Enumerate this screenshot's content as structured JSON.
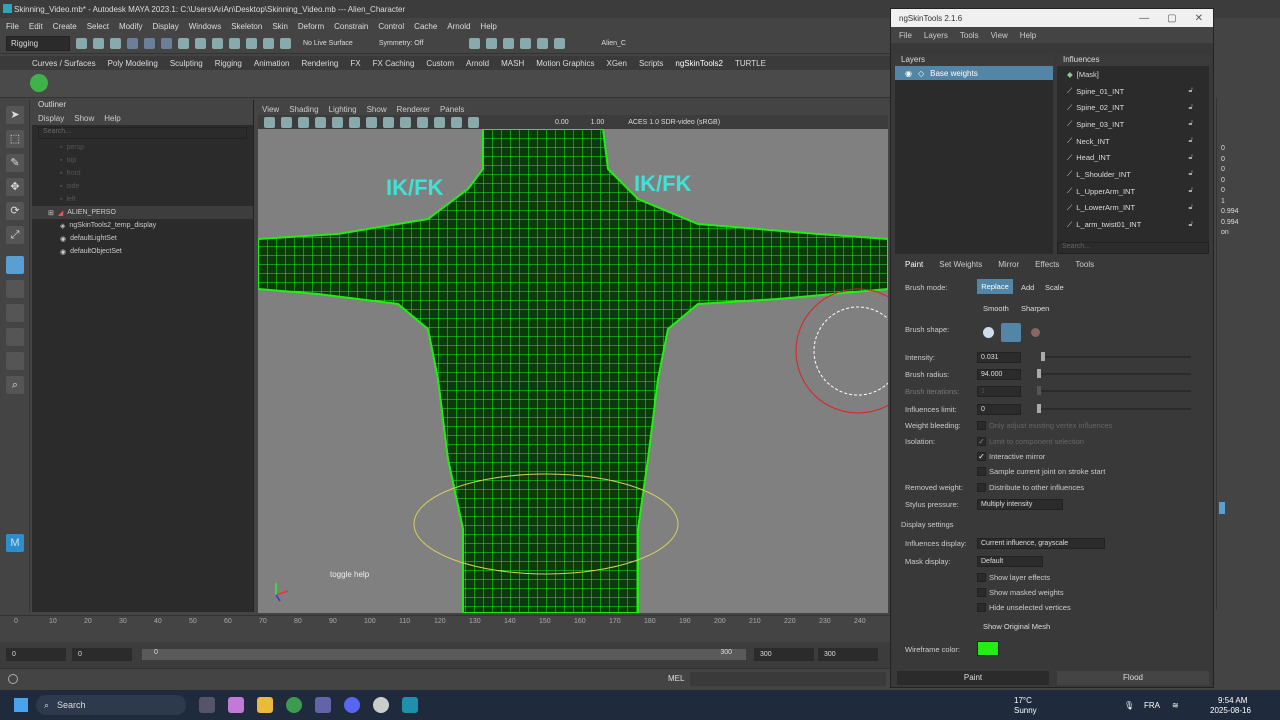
{
  "window": {
    "title": "Skinning_Video.mb* - Autodesk MAYA 2023.1: C:\\Users\\AriAn\\Desktop\\Skinning_Video.mb  ---  Alien_Character"
  },
  "menubar": [
    "File",
    "Edit",
    "Create",
    "Select",
    "Modify",
    "Display",
    "Windows",
    "Skeleton",
    "Skin",
    "Deform",
    "Constrain",
    "Control",
    "Cache",
    "Arnold",
    "Help"
  ],
  "statusline": {
    "menuset": "Rigging",
    "live_surface": "No Live Surface",
    "symmetry": "Symmetry: Off",
    "workspace": "Alien_C"
  },
  "shelf_tabs": [
    "Curves / Surfaces",
    "Poly Modeling",
    "Sculpting",
    "Rigging",
    "Animation",
    "Rendering",
    "FX",
    "FX Caching",
    "Custom",
    "Arnold",
    "MASH",
    "Motion Graphics",
    "XGen",
    "Scripts",
    "ngSkinTools2",
    "TURTLE"
  ],
  "outliner": {
    "title": "Outliner",
    "menu": [
      "Display",
      "Show",
      "Help"
    ],
    "search_placeholder": "Search...",
    "items": [
      {
        "label": "persp",
        "dim": true
      },
      {
        "label": "top",
        "dim": true
      },
      {
        "label": "front",
        "dim": true
      },
      {
        "label": "side",
        "dim": true
      },
      {
        "label": "left",
        "dim": true
      },
      {
        "label": "ALIEN_PERSO",
        "dim": false
      },
      {
        "label": "ngSkinTools2_temp_display",
        "dim": false
      },
      {
        "label": "defaultLightSet",
        "dim": false
      },
      {
        "label": "defaultObjectSet",
        "dim": false
      }
    ]
  },
  "viewport": {
    "menu": [
      "View",
      "Shading",
      "Lighting",
      "Show",
      "Renderer",
      "Panels"
    ],
    "exposure": "0.00",
    "gamma": "1.00",
    "colorspace": "ACES 1.0 SDR-video (sRGB)",
    "label_left": "IK/FK",
    "label_right": "IK/FK",
    "toggle_help": "toggle help"
  },
  "timeline": {
    "ticks": [
      "0",
      "10",
      "20",
      "30",
      "40",
      "50",
      "60",
      "70",
      "80",
      "90",
      "100",
      "110",
      "120",
      "130",
      "140",
      "150",
      "160",
      "170",
      "180",
      "190",
      "200",
      "210",
      "220",
      "230",
      "240"
    ],
    "range_start": "0",
    "range_start2": "0",
    "range_inner_start": "0",
    "range_inner_end": "300",
    "range_end": "300",
    "range_end2": "300"
  },
  "cmdline": {
    "label": "MEL"
  },
  "ngskin": {
    "title": "ngSkinTools 2.1.6",
    "menu": [
      "File",
      "Layers",
      "Tools",
      "View",
      "Help"
    ],
    "layers_header": "Layers",
    "layer": "Base weights",
    "influences_header": "Influences",
    "influences": [
      "[Mask]",
      "Spine_01_INT",
      "Spine_02_INT",
      "Spine_03_INT",
      "Neck_INT",
      "Head_INT",
      "L_Shoulder_INT",
      "L_UpperArm_INT",
      "L_LowerArm_INT",
      "L_arm_twist01_INT"
    ],
    "influence_search_placeholder": "Search...",
    "tabs": [
      "Paint",
      "Set Weights",
      "Mirror",
      "Effects",
      "Tools"
    ],
    "brush_mode_label": "Brush mode:",
    "brush_modes": [
      "Replace",
      "Add",
      "Scale",
      "Smooth",
      "Sharpen"
    ],
    "brush_shape_label": "Brush shape:",
    "intensity_label": "Intensity:",
    "intensity": "0.031",
    "radius_label": "Brush radius:",
    "radius": "94.000",
    "iterations_label": "Brush iterations:",
    "iterations": "1",
    "influences_limit_label": "Influences limit:",
    "influences_limit": "0",
    "weight_bleeding_label": "Weight bleeding:",
    "weight_bleeding_opt": "Only adjust existing vertex influences",
    "isolation_label": "Isolation:",
    "isolation_opt": "Limit to component selection",
    "interactive_mirror": "Interactive mirror",
    "sample_joint": "Sample current joint on stroke start",
    "removed_weight_label": "Removed weight:",
    "distribute": "Distribute to other influences",
    "stylus_label": "Stylus pressure:",
    "stylus_value": "Multiply intensity",
    "display_settings": "Display settings",
    "influences_display_label": "Influences display:",
    "influences_display_value": "Current influence, grayscale",
    "mask_display_label": "Mask display:",
    "mask_display_value": "Default",
    "show_layer_effects": "Show layer effects",
    "show_masked_weights": "Show masked weights",
    "hide_unselected": "Hide unselected vertices",
    "show_original_mesh": "Show Original Mesh",
    "wireframe_color_label": "Wireframe color:",
    "wireframe_color": "#22ee11",
    "paint_button": "Paint",
    "flood_button": "Flood"
  },
  "channel_values": [
    "0",
    "0",
    "0",
    "0",
    "0",
    "1",
    "0.994",
    "0.994",
    "on"
  ],
  "taskbar": {
    "search": "Search",
    "weather_temp": "17°C",
    "weather_desc": "Sunny",
    "lang": "FRA",
    "time": "9:54 AM",
    "date": "2025-08-16"
  },
  "colors": {
    "accent": "#5285a6",
    "wireframe": "#22ee11",
    "taskbar": "#1f2b3d"
  }
}
